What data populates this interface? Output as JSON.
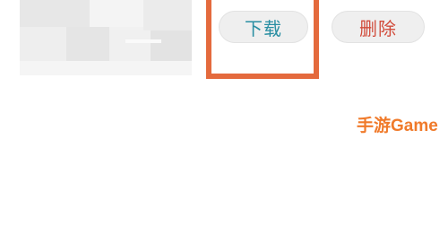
{
  "item": {
    "thumbnail_label": "blurred-preview"
  },
  "actions": {
    "download_label": "下载",
    "delete_label": "删除"
  },
  "highlight": {
    "color": "#e46a3d"
  },
  "watermark": {
    "text": "手游Game",
    "color": "#f07a2a"
  },
  "colors": {
    "download_text": "#2a8fa3",
    "delete_text": "#d14b3a",
    "button_bg": "#efefef"
  }
}
